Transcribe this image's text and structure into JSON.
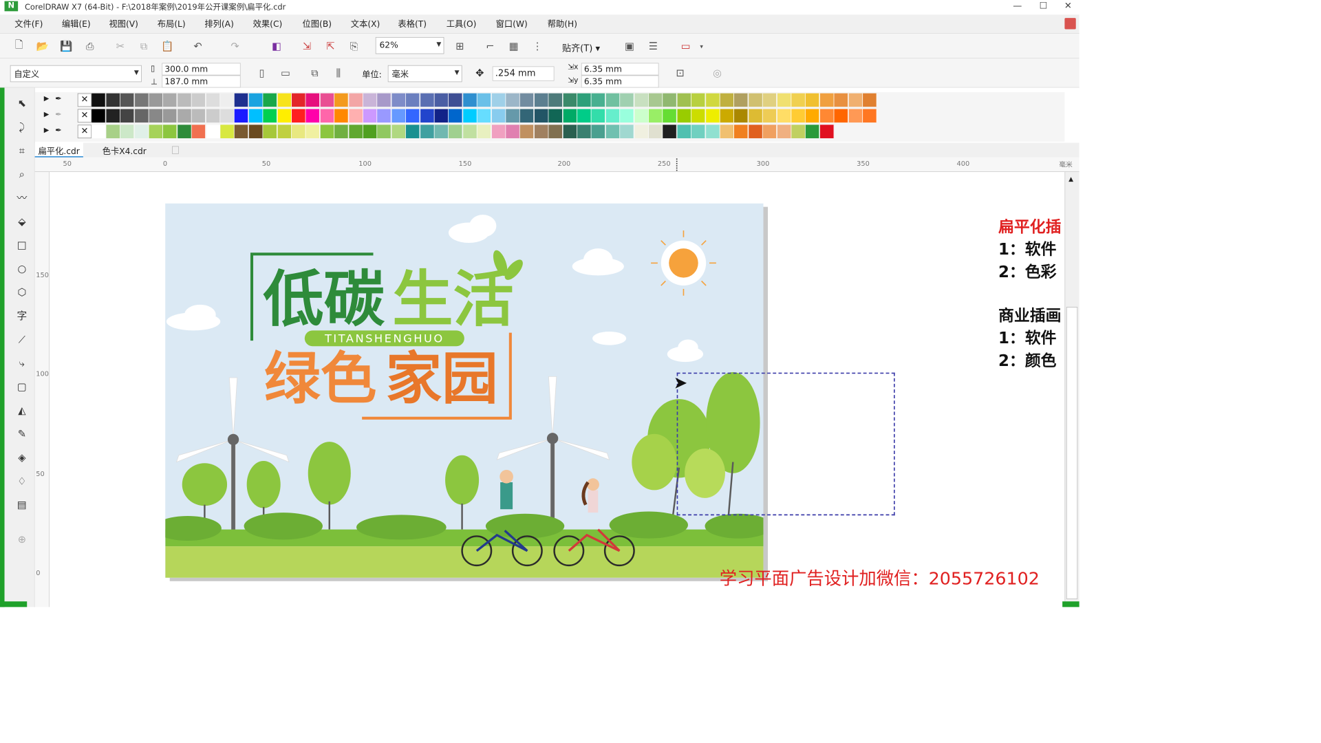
{
  "app": {
    "title": "CorelDRAW X7 (64-Bit) - F:\\2018年案例\\2019年公开课案例\\扁平化.cdr"
  },
  "menu": [
    "文件(F)",
    "编辑(E)",
    "视图(V)",
    "布局(L)",
    "排列(A)",
    "效果(C)",
    "位图(B)",
    "文本(X)",
    "表格(T)",
    "工具(O)",
    "窗口(W)",
    "帮助(H)"
  ],
  "toolbar": {
    "zoom": "62%",
    "snap": "贴齐(T)"
  },
  "props": {
    "preset": "自定义",
    "width": "300.0 mm",
    "height": "187.0 mm",
    "units_label": "单位:",
    "units": "毫米",
    "nudge": ".254 mm",
    "dup_x": "6.35 mm",
    "dup_y": "6.35 mm"
  },
  "tabs": [
    "扁平化.cdr",
    "色卡X4.cdr"
  ],
  "ruler": {
    "h": [
      "50",
      "0",
      "50",
      "100",
      "150",
      "200",
      "250",
      "300",
      "350",
      "400",
      "毫米"
    ],
    "v": [
      "150",
      "100",
      "50",
      "0"
    ]
  },
  "artwork": {
    "title1": "低碳",
    "title2": "生活",
    "pinyin": "TITANSHENGHUO",
    "title3": "绿色",
    "title4": "家园"
  },
  "notes": {
    "heading": "扁平化插",
    "l1": "1：软件",
    "l2": "2：色彩",
    "heading2": "商业插画",
    "l3": "1：软件",
    "l4": "2：颜色"
  },
  "watermark": "学习平面广告设计加微信：2055726102",
  "colors": {
    "accent_red": "#e02020",
    "green": "#2e8b3a",
    "lime": "#8cc63f",
    "orange": "#f0883a"
  }
}
